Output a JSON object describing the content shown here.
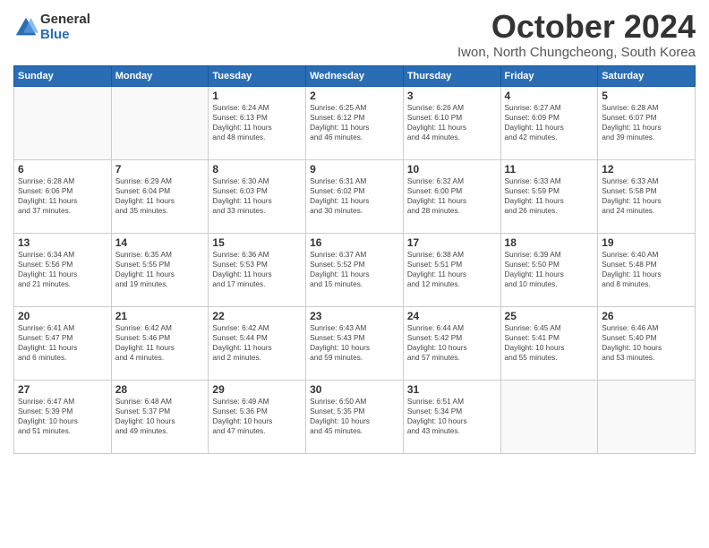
{
  "logo": {
    "general": "General",
    "blue": "Blue"
  },
  "title": "October 2024",
  "subtitle": "Iwon, North Chungcheong, South Korea",
  "days_of_week": [
    "Sunday",
    "Monday",
    "Tuesday",
    "Wednesday",
    "Thursday",
    "Friday",
    "Saturday"
  ],
  "weeks": [
    [
      {
        "day": "",
        "info": ""
      },
      {
        "day": "",
        "info": ""
      },
      {
        "day": "1",
        "info": "Sunrise: 6:24 AM\nSunset: 6:13 PM\nDaylight: 11 hours\nand 48 minutes."
      },
      {
        "day": "2",
        "info": "Sunrise: 6:25 AM\nSunset: 6:12 PM\nDaylight: 11 hours\nand 46 minutes."
      },
      {
        "day": "3",
        "info": "Sunrise: 6:26 AM\nSunset: 6:10 PM\nDaylight: 11 hours\nand 44 minutes."
      },
      {
        "day": "4",
        "info": "Sunrise: 6:27 AM\nSunset: 6:09 PM\nDaylight: 11 hours\nand 42 minutes."
      },
      {
        "day": "5",
        "info": "Sunrise: 6:28 AM\nSunset: 6:07 PM\nDaylight: 11 hours\nand 39 minutes."
      }
    ],
    [
      {
        "day": "6",
        "info": "Sunrise: 6:28 AM\nSunset: 6:06 PM\nDaylight: 11 hours\nand 37 minutes."
      },
      {
        "day": "7",
        "info": "Sunrise: 6:29 AM\nSunset: 6:04 PM\nDaylight: 11 hours\nand 35 minutes."
      },
      {
        "day": "8",
        "info": "Sunrise: 6:30 AM\nSunset: 6:03 PM\nDaylight: 11 hours\nand 33 minutes."
      },
      {
        "day": "9",
        "info": "Sunrise: 6:31 AM\nSunset: 6:02 PM\nDaylight: 11 hours\nand 30 minutes."
      },
      {
        "day": "10",
        "info": "Sunrise: 6:32 AM\nSunset: 6:00 PM\nDaylight: 11 hours\nand 28 minutes."
      },
      {
        "day": "11",
        "info": "Sunrise: 6:33 AM\nSunset: 5:59 PM\nDaylight: 11 hours\nand 26 minutes."
      },
      {
        "day": "12",
        "info": "Sunrise: 6:33 AM\nSunset: 5:58 PM\nDaylight: 11 hours\nand 24 minutes."
      }
    ],
    [
      {
        "day": "13",
        "info": "Sunrise: 6:34 AM\nSunset: 5:56 PM\nDaylight: 11 hours\nand 21 minutes."
      },
      {
        "day": "14",
        "info": "Sunrise: 6:35 AM\nSunset: 5:55 PM\nDaylight: 11 hours\nand 19 minutes."
      },
      {
        "day": "15",
        "info": "Sunrise: 6:36 AM\nSunset: 5:53 PM\nDaylight: 11 hours\nand 17 minutes."
      },
      {
        "day": "16",
        "info": "Sunrise: 6:37 AM\nSunset: 5:52 PM\nDaylight: 11 hours\nand 15 minutes."
      },
      {
        "day": "17",
        "info": "Sunrise: 6:38 AM\nSunset: 5:51 PM\nDaylight: 11 hours\nand 12 minutes."
      },
      {
        "day": "18",
        "info": "Sunrise: 6:39 AM\nSunset: 5:50 PM\nDaylight: 11 hours\nand 10 minutes."
      },
      {
        "day": "19",
        "info": "Sunrise: 6:40 AM\nSunset: 5:48 PM\nDaylight: 11 hours\nand 8 minutes."
      }
    ],
    [
      {
        "day": "20",
        "info": "Sunrise: 6:41 AM\nSunset: 5:47 PM\nDaylight: 11 hours\nand 6 minutes."
      },
      {
        "day": "21",
        "info": "Sunrise: 6:42 AM\nSunset: 5:46 PM\nDaylight: 11 hours\nand 4 minutes."
      },
      {
        "day": "22",
        "info": "Sunrise: 6:42 AM\nSunset: 5:44 PM\nDaylight: 11 hours\nand 2 minutes."
      },
      {
        "day": "23",
        "info": "Sunrise: 6:43 AM\nSunset: 5:43 PM\nDaylight: 10 hours\nand 59 minutes."
      },
      {
        "day": "24",
        "info": "Sunrise: 6:44 AM\nSunset: 5:42 PM\nDaylight: 10 hours\nand 57 minutes."
      },
      {
        "day": "25",
        "info": "Sunrise: 6:45 AM\nSunset: 5:41 PM\nDaylight: 10 hours\nand 55 minutes."
      },
      {
        "day": "26",
        "info": "Sunrise: 6:46 AM\nSunset: 5:40 PM\nDaylight: 10 hours\nand 53 minutes."
      }
    ],
    [
      {
        "day": "27",
        "info": "Sunrise: 6:47 AM\nSunset: 5:39 PM\nDaylight: 10 hours\nand 51 minutes."
      },
      {
        "day": "28",
        "info": "Sunrise: 6:48 AM\nSunset: 5:37 PM\nDaylight: 10 hours\nand 49 minutes."
      },
      {
        "day": "29",
        "info": "Sunrise: 6:49 AM\nSunset: 5:36 PM\nDaylight: 10 hours\nand 47 minutes."
      },
      {
        "day": "30",
        "info": "Sunrise: 6:50 AM\nSunset: 5:35 PM\nDaylight: 10 hours\nand 45 minutes."
      },
      {
        "day": "31",
        "info": "Sunrise: 6:51 AM\nSunset: 5:34 PM\nDaylight: 10 hours\nand 43 minutes."
      },
      {
        "day": "",
        "info": ""
      },
      {
        "day": "",
        "info": ""
      }
    ]
  ]
}
